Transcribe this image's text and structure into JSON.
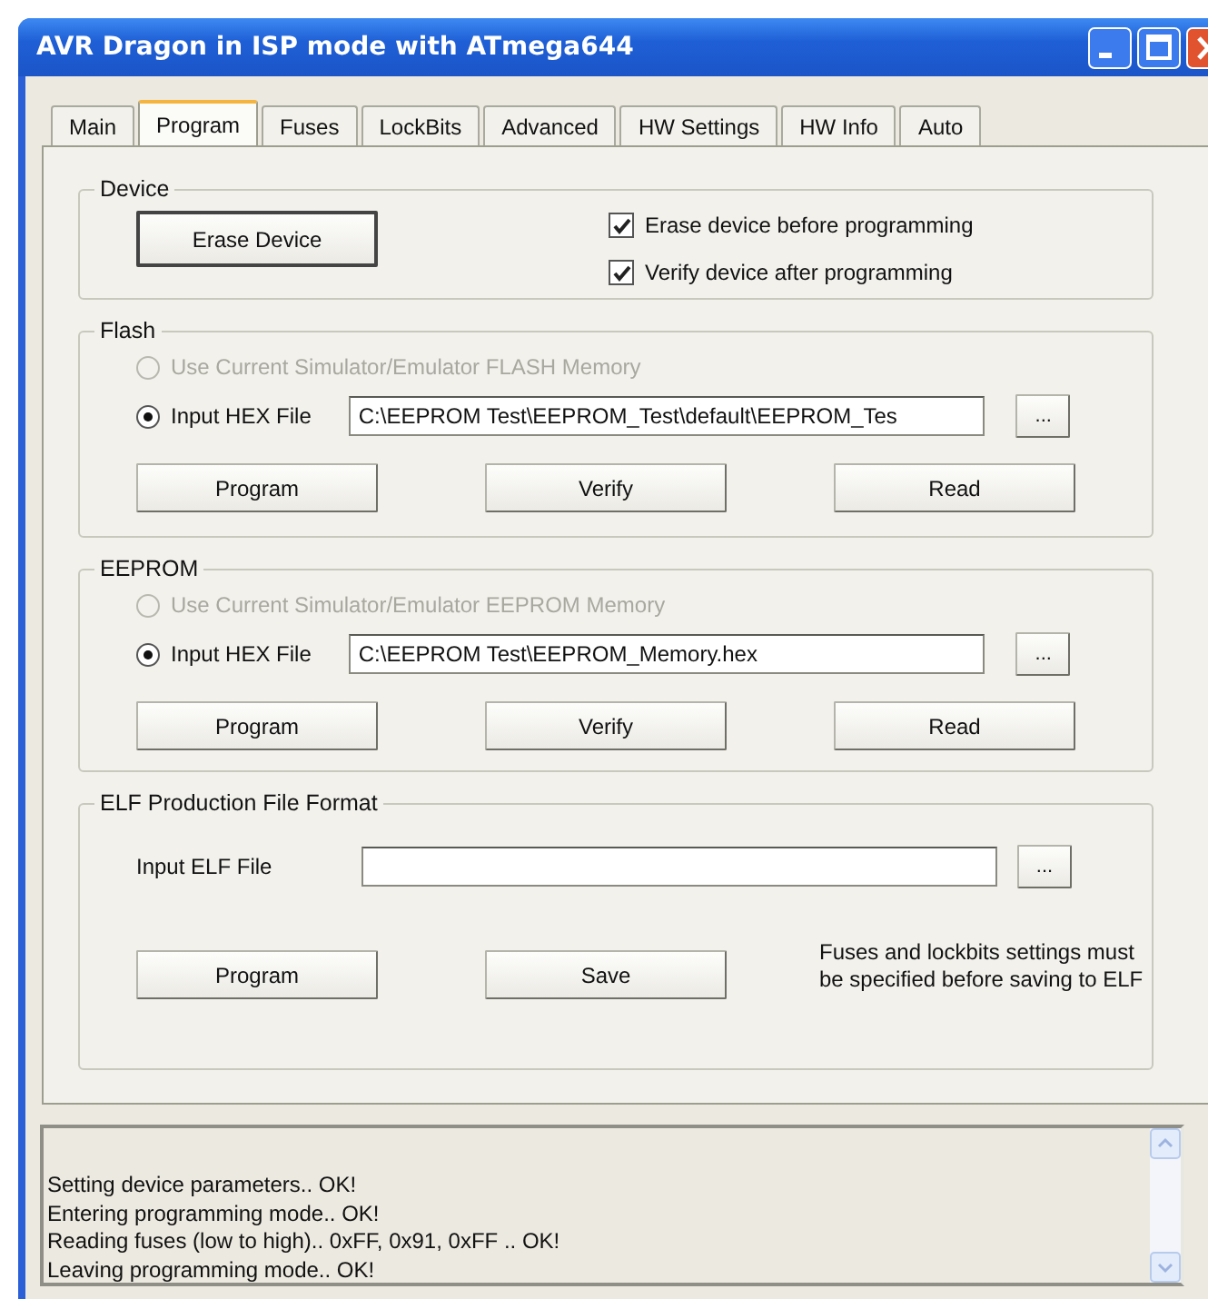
{
  "window": {
    "title": "AVR Dragon in ISP mode with ATmega644"
  },
  "tabs": [
    {
      "label": "Main",
      "selected": false
    },
    {
      "label": "Program",
      "selected": true
    },
    {
      "label": "Fuses",
      "selected": false
    },
    {
      "label": "LockBits",
      "selected": false
    },
    {
      "label": "Advanced",
      "selected": false
    },
    {
      "label": "HW Settings",
      "selected": false
    },
    {
      "label": "HW Info",
      "selected": false
    },
    {
      "label": "Auto",
      "selected": false
    }
  ],
  "device": {
    "title": "Device",
    "erase_button": "Erase Device",
    "options": [
      {
        "label": "Erase device before programming",
        "checked": true
      },
      {
        "label": "Verify device after programming",
        "checked": true
      }
    ]
  },
  "flash": {
    "title": "Flash",
    "sources": [
      {
        "label": "Use Current Simulator/Emulator FLASH Memory",
        "selected": false,
        "disabled": true
      },
      {
        "label": "Input HEX File",
        "selected": true,
        "disabled": false
      }
    ],
    "file": "C:\\EEPROM Test\\EEPROM_Test\\default\\EEPROM_Tes",
    "browse": "...",
    "buttons": [
      "Program",
      "Verify",
      "Read"
    ]
  },
  "eeprom": {
    "title": "EEPROM",
    "sources": [
      {
        "label": "Use Current Simulator/Emulator EEPROM Memory",
        "selected": false,
        "disabled": true
      },
      {
        "label": "Input HEX File",
        "selected": true,
        "disabled": false
      }
    ],
    "file": "C:\\EEPROM Test\\EEPROM_Memory.hex",
    "browse": "...",
    "buttons": [
      "Program",
      "Verify",
      "Read"
    ]
  },
  "elf": {
    "title": "ELF Production File Format",
    "file_label": "Input ELF File",
    "browse": "...",
    "buttons": [
      "Program",
      "Save"
    ],
    "note": "Fuses and lockbits settings must be specified before saving to ELF"
  },
  "log": {
    "lines": [
      "Setting device parameters.. OK!",
      "Entering programming mode.. OK!",
      "Reading fuses (low to high).. 0xFF, 0x91, 0xFF .. OK!",
      "Leaving programming mode.. OK!"
    ]
  }
}
